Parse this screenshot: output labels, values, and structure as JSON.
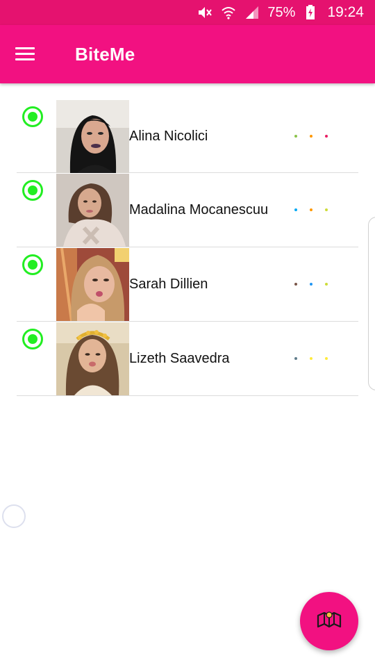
{
  "status_bar": {
    "battery_percent": "75%",
    "time": "19:24",
    "icons": [
      "mute-icon",
      "wifi-icon",
      "signal-icon",
      "battery-charging-icon"
    ]
  },
  "app_bar": {
    "title": "BiteMe",
    "menu_icon": "hamburger-menu-icon"
  },
  "contacts": [
    {
      "name": "Alina Nicolici",
      "online": true,
      "dot_colors": [
        "#8bc34a",
        "#ff9800",
        "#e91e63"
      ]
    },
    {
      "name": "Madalina Mocanescuu",
      "online": true,
      "dot_colors": [
        "#03a9f4",
        "#ff9800",
        "#cddc39"
      ]
    },
    {
      "name": "Sarah Dillien",
      "online": true,
      "dot_colors": [
        "#795548",
        "#2196f3",
        "#cddc39"
      ]
    },
    {
      "name": "Lizeth Saavedra",
      "online": true,
      "dot_colors": [
        "#607d8b",
        "#ffeb3b",
        "#ffeb3b"
      ]
    }
  ],
  "fab": {
    "icon": "map-icon"
  },
  "colors": {
    "primary": "#f21181",
    "primary_dark": "#e5126f",
    "online": "#22ee22"
  }
}
